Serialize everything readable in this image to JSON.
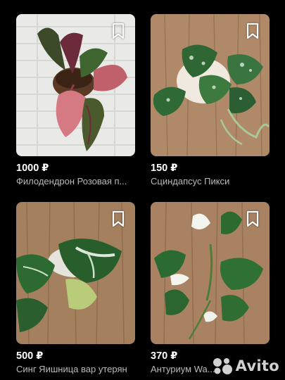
{
  "listings": [
    {
      "price": "1000 ₽",
      "title": "Филодендрон Розовая п...",
      "image": "philodendron-pink-princess-photo"
    },
    {
      "price": "150 ₽",
      "title": "Сциндапсус Пикси",
      "image": "scindapsus-pixie-photo"
    },
    {
      "price": "500 ₽",
      "title": "Синг Яишница вар утерян",
      "image": "syngonium-photo"
    },
    {
      "price": "370 ₽",
      "title": "Антуриум Wa...",
      "image": "anthurium-white-photo"
    }
  ],
  "icons": {
    "favorite": "bookmark-icon"
  },
  "watermark": {
    "text": "Avito",
    "logo": "avito-logo-icon"
  },
  "colors": {
    "background": "#000000",
    "price": "#ffffff",
    "title": "#b9b9b9"
  }
}
